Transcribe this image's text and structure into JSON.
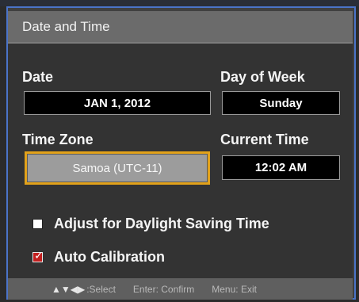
{
  "window": {
    "title": "Date and Time"
  },
  "labels": {
    "date": "Date",
    "day_of_week": "Day of Week",
    "time_zone": "Time Zone",
    "current_time": "Current Time"
  },
  "fields": {
    "date_value": "JAN 1, 2012",
    "day_value": "Sunday",
    "time_zone_value": "Samoa (UTC-11)",
    "current_time_value": "12:02 AM"
  },
  "options": [
    {
      "label": "Adjust for Daylight Saving Time",
      "checked": false
    },
    {
      "label": "Auto Calibration",
      "checked": true
    }
  ],
  "footer": {
    "arrows": "▲▼◀▶",
    "select": ":Select",
    "confirm": "Enter: Confirm",
    "exit": "Menu: Exit"
  },
  "colors": {
    "accent_border": "#4b74c8",
    "selection_highlight": "#e2a21b",
    "checked_box": "#c21f1f"
  }
}
